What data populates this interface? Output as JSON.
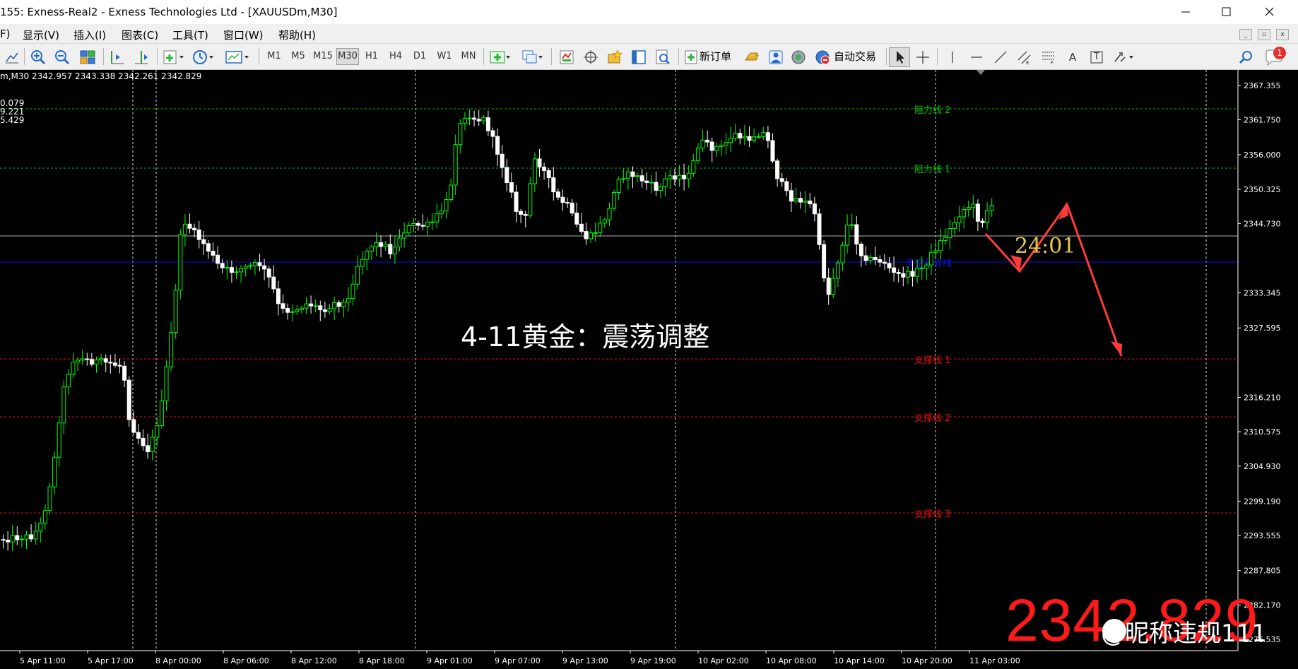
{
  "window": {
    "title": "155: Exness-Real2 - Exness Technologies Ltd - [XAUUSDm,M30]",
    "controls": {
      "minimize": "—",
      "maximize": "☐",
      "close": "✕"
    }
  },
  "menu": {
    "items": [
      "F)",
      "显示(V)",
      "插入(I)",
      "图表(C)",
      "工具(T)",
      "窗口(W)",
      "帮助(H)"
    ],
    "mdi_buttons": [
      "_",
      "▫",
      "x"
    ]
  },
  "toolbar": {
    "timeframes": [
      "M1",
      "M5",
      "M15",
      "M30",
      "H1",
      "H4",
      "D1",
      "W1",
      "MN"
    ],
    "selected_timeframe": "M30",
    "new_order_label": "新订单",
    "auto_trade_label": "自动交易",
    "text_tool": "A",
    "label_tool": "T",
    "notification_badge": "1"
  },
  "chart": {
    "symbol_period": "m,M30",
    "ohlc": "2342.957 2343.338 2342.261 2342.829",
    "indicator_values": [
      "0.079",
      "9.221",
      "5.429"
    ],
    "current_price": "2342.829",
    "big_price_overlay": "2342.829",
    "annotation_main": "4-11黄金：震荡调整",
    "countdown": "24:01",
    "watermark": "@昵称违规111",
    "horizontal_lines": [
      {
        "label": "阻力线 2",
        "price": "2363.493",
        "color": "#00c000"
      },
      {
        "label": "阻力线 1",
        "price": "2353.851",
        "color": "#00c000"
      },
      {
        "label": "多空分界线",
        "price": "2339.890",
        "color": "#1010e0"
      },
      {
        "label": "支撑线 1",
        "price": "2321.635",
        "color": "#e01010"
      },
      {
        "label": "支撑线 2",
        "price": "2312.993",
        "color": "#e01010"
      },
      {
        "label": "支撑线 3",
        "price": "2297.385",
        "color": "#e01010"
      }
    ],
    "price_ticks": [
      "2367.355",
      "2361.750",
      "2356.000",
      "2350.325",
      "2344.730",
      "2333.345",
      "2327.595",
      "2316.210",
      "2310.575",
      "2304.930",
      "2299.190",
      "2293.555",
      "2287.805",
      "2282.170",
      "2276.535"
    ],
    "time_ticks": [
      "5 Apr 11:00",
      "5 Apr 17:00",
      "8 Apr 00:00",
      "8 Apr 06:00",
      "8 Apr 12:00",
      "8 Apr 18:00",
      "9 Apr 01:00",
      "9 Apr 07:00",
      "9 Apr 13:00",
      "9 Apr 19:00",
      "10 Apr 02:00",
      "10 Apr 08:00",
      "10 Apr 14:00",
      "10 Apr 20:00",
      "11 Apr 03:00"
    ],
    "colors": {
      "background": "#000000",
      "bull": "#00ff00",
      "bear": "#ffffff",
      "axis": "#ffffff",
      "forecast_arrow": "#ff3b3b"
    }
  }
}
